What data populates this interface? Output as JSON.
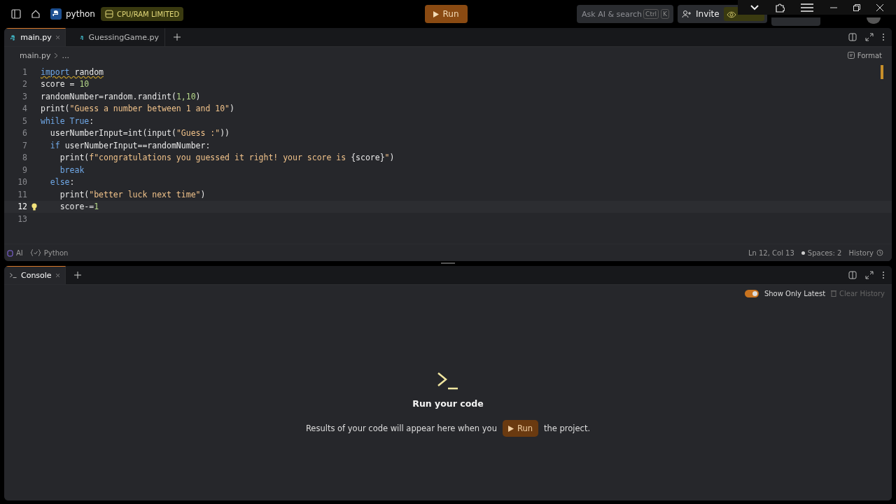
{
  "topbar": {
    "project": "python",
    "badge": "CPU/RAM LIMITED",
    "run": "Run",
    "search": {
      "placeholder": "Ask AI & search",
      "keys": [
        "Ctrl",
        "K"
      ]
    },
    "invite": "Invite"
  },
  "tabs": [
    {
      "label": "main.py",
      "selected": true,
      "closable": true
    },
    {
      "label": "GuessingGame.py",
      "selected": false,
      "closable": false
    }
  ],
  "breadcrumb": [
    "main.py",
    "..."
  ],
  "format": "Format",
  "code": [
    {
      "n": "1",
      "current": false,
      "hint": false,
      "warning": true,
      "tokens": [
        {
          "t": "import",
          "kind": "keyword"
        },
        {
          "t": " random",
          "kind": "name"
        }
      ]
    },
    {
      "n": "2",
      "current": false,
      "hint": false,
      "warning": false,
      "tokens": [
        {
          "t": "score = ",
          "kind": "name"
        },
        {
          "t": "10",
          "kind": "number"
        }
      ]
    },
    {
      "n": "3",
      "current": false,
      "hint": false,
      "warning": false,
      "tokens": [
        {
          "t": "randomNumber=random.randint(",
          "kind": "name"
        },
        {
          "t": "1,10",
          "kind": "number"
        },
        {
          "t": ")",
          "kind": "name"
        }
      ]
    },
    {
      "n": "4",
      "current": false,
      "hint": false,
      "warning": false,
      "tokens": [
        {
          "t": "print(",
          "kind": "name"
        },
        {
          "t": "\"Guess a number between 1 and 10\"",
          "kind": "string"
        },
        {
          "t": ")",
          "kind": "name"
        }
      ]
    },
    {
      "n": "5",
      "current": false,
      "hint": false,
      "warning": false,
      "tokens": [
        {
          "t": "while True",
          "kind": "keyword"
        },
        {
          "t": ":",
          "kind": "name"
        }
      ]
    },
    {
      "n": "6",
      "current": false,
      "hint": false,
      "warning": false,
      "tokens": [
        {
          "t": "  userNumberInput=int(input(",
          "kind": "name"
        },
        {
          "t": "\"Guess :\"",
          "kind": "string"
        },
        {
          "t": "))",
          "kind": "name"
        }
      ]
    },
    {
      "n": "7",
      "current": false,
      "hint": false,
      "warning": false,
      "tokens": [
        {
          "t": "  if",
          "kind": "keyword"
        },
        {
          "t": " userNumberInput==randomNumber:",
          "kind": "name"
        }
      ]
    },
    {
      "n": "8",
      "current": false,
      "hint": false,
      "warning": false,
      "tokens": [
        {
          "t": "    print(",
          "kind": "name"
        },
        {
          "t": "f\"congratulations you guessed it right! your score is ",
          "kind": "string"
        },
        {
          "t": "{score}",
          "kind": "name"
        },
        {
          "t": "\"",
          "kind": "string"
        },
        {
          "t": ")",
          "kind": "name"
        }
      ]
    },
    {
      "n": "9",
      "current": false,
      "hint": false,
      "warning": false,
      "tokens": [
        {
          "t": "    break",
          "kind": "keyword"
        }
      ]
    },
    {
      "n": "10",
      "current": false,
      "hint": false,
      "warning": false,
      "tokens": [
        {
          "t": "  else",
          "kind": "keyword"
        },
        {
          "t": ":",
          "kind": "name"
        }
      ]
    },
    {
      "n": "11",
      "current": false,
      "hint": false,
      "warning": false,
      "tokens": [
        {
          "t": "    print(",
          "kind": "name"
        },
        {
          "t": "\"better luck next time\"",
          "kind": "string"
        },
        {
          "t": ")",
          "kind": "name"
        }
      ]
    },
    {
      "n": "12",
      "current": true,
      "hint": true,
      "warning": false,
      "tokens": [
        {
          "t": "    score-=",
          "kind": "name"
        },
        {
          "t": "1",
          "kind": "number"
        }
      ]
    },
    {
      "n": "13",
      "current": false,
      "hint": false,
      "warning": false
    }
  ],
  "status": {
    "ai": "AI",
    "language": "Python",
    "position": "Ln 12, Col 13",
    "spaces": "Spaces: 2",
    "history": "History"
  },
  "console": {
    "tab": "Console",
    "show_latest": {
      "label": "Show Only Latest",
      "on": true
    },
    "clear": "Clear History",
    "empty_title": "Run your code",
    "empty_before": "Results of your code will appear here when you",
    "empty_button": "Run",
    "empty_after": "the project."
  }
}
